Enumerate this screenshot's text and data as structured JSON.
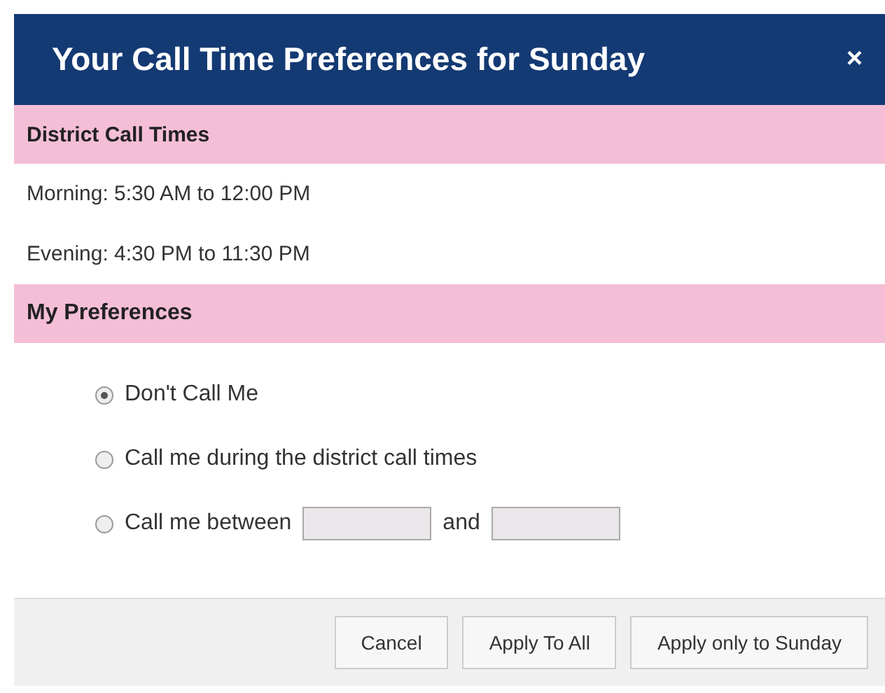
{
  "dialog": {
    "title": "Your Call Time Preferences for Sunday",
    "close": "×"
  },
  "district": {
    "heading": "District Call Times",
    "lines": [
      "Morning: 5:30 AM to 12:00 PM",
      "Evening: 4:30 PM to 11:30 PM"
    ]
  },
  "preferences": {
    "heading": "My Preferences",
    "options": [
      {
        "kind": "plain",
        "label": "Don't Call Me",
        "selected": true
      },
      {
        "kind": "plain",
        "label": "Call me during the district call times",
        "selected": false
      },
      {
        "kind": "range",
        "label": "Call me between",
        "joiner": "and",
        "selected": false
      }
    ]
  },
  "buttons": [
    "Cancel",
    "Apply To All",
    "Apply only to Sunday"
  ]
}
